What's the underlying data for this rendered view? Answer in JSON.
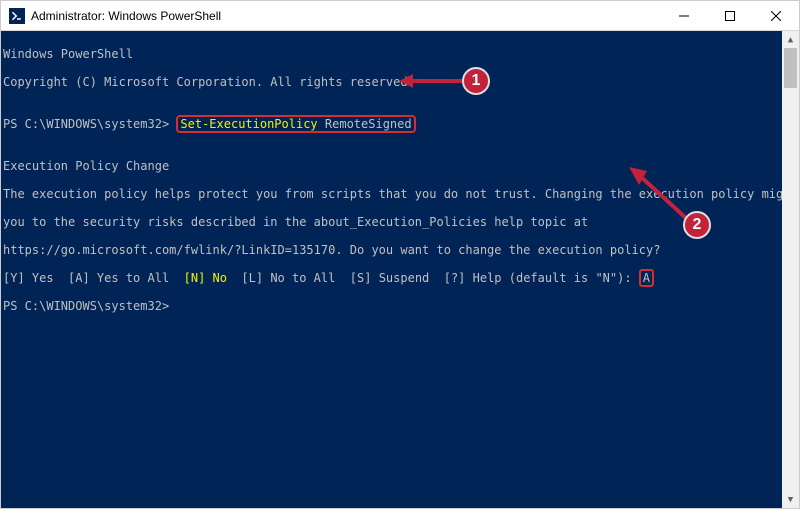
{
  "window": {
    "title": "Administrator: Windows PowerShell"
  },
  "console": {
    "heading1": "Windows PowerShell",
    "heading2": "Copyright (C) Microsoft Corporation. All rights reserved.",
    "prompt1_prefix": "PS C:\\WINDOWS\\system32> ",
    "command_span1": "Set-ExecutionPolicy",
    "command_span2": "RemoteSigned",
    "blank": "",
    "policy_title": "Execution Policy Change",
    "policy_l1": "The execution policy helps protect you from scripts that you do not trust. Changing the execution policy might expose",
    "policy_l2": "you to the security risks described in the about_Execution_Policies help topic at",
    "policy_l3": "https://go.microsoft.com/fwlink/?LinkID=135170. Do you want to change the execution policy?",
    "choices_pre": "[Y] Yes  [A] Yes to All  ",
    "choices_no": "[N] No",
    "choices_post1": "  [L] No to All  [S] Suspend  [?] Help (default is \"N\"): ",
    "choices_input": "A",
    "prompt2": "PS C:\\WINDOWS\\system32>"
  },
  "annotations": {
    "badge1": "1",
    "badge2": "2"
  }
}
